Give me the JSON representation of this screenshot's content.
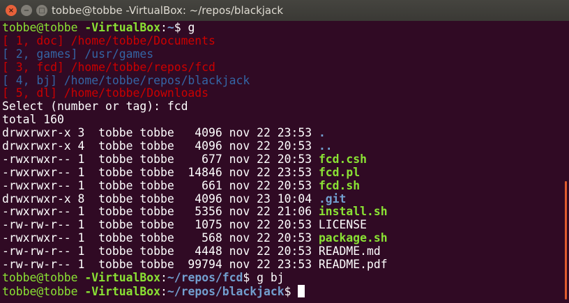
{
  "window": {
    "title": "tobbe@tobbe -VirtualBox: ~/repos/blackjack",
    "close_icon": "×",
    "minimize_icon": "−",
    "maximize_icon": "□"
  },
  "colors": {
    "background": "#300a24",
    "prompt_user": "#8ae234",
    "prompt_path": "#729fcf",
    "red": "#cc0000",
    "blue": "#3465a4",
    "scrollbar": "#e05c2e"
  },
  "terminal": {
    "lines": [
      [
        {
          "t": "tobbe@tobbe",
          "c": "ug"
        },
        {
          "t": " -VirtualBox",
          "c": "ugb"
        },
        {
          "t": ":",
          "c": "w"
        },
        {
          "t": "~",
          "c": "ubb"
        },
        {
          "t": "$ g",
          "c": "w"
        }
      ],
      [
        {
          "t": "[ 1, doc] /home/tobbe/Documents",
          "c": "red"
        }
      ],
      [
        {
          "t": "[ 2, games] /usr/games",
          "c": "blue"
        }
      ],
      [
        {
          "t": "[ 3, fcd] /home/tobbe/repos/fcd",
          "c": "red"
        }
      ],
      [
        {
          "t": "[ 4, bj] /home/tobbe/repos/blackjack",
          "c": "blue"
        }
      ],
      [
        {
          "t": "[ 5, dl] /home/tobbe/Downloads",
          "c": "red"
        }
      ],
      [
        {
          "t": "Select (number or tag): fcd",
          "c": "w"
        }
      ],
      [
        {
          "t": "total 160",
          "c": "w"
        }
      ],
      [
        {
          "t": "drwxrwxr-x 3  tobbe tobbe   4096 nov 22 23:53 ",
          "c": "w"
        },
        {
          "t": ".",
          "c": "dir"
        }
      ],
      [
        {
          "t": "drwxrwxr-x 4  tobbe tobbe   4096 nov 22 20:53 ",
          "c": "w"
        },
        {
          "t": "..",
          "c": "dir"
        }
      ],
      [
        {
          "t": "-rwxrwxr-- 1  tobbe tobbe    677 nov 22 20:53 ",
          "c": "w"
        },
        {
          "t": "fcd.csh",
          "c": "exe"
        }
      ],
      [
        {
          "t": "-rwxrwxr-- 1  tobbe tobbe  14846 nov 22 23:53 ",
          "c": "w"
        },
        {
          "t": "fcd.pl",
          "c": "exe"
        }
      ],
      [
        {
          "t": "-rwxrwxr-- 1  tobbe tobbe    661 nov 22 20:53 ",
          "c": "w"
        },
        {
          "t": "fcd.sh",
          "c": "exe"
        }
      ],
      [
        {
          "t": "drwxrwxr-x 8  tobbe tobbe   4096 nov 23 10:04 ",
          "c": "w"
        },
        {
          "t": ".git",
          "c": "dir"
        }
      ],
      [
        {
          "t": "-rwxrwxr-- 1  tobbe tobbe   5356 nov 22 21:06 ",
          "c": "w"
        },
        {
          "t": "install.sh",
          "c": "exe"
        }
      ],
      [
        {
          "t": "-rw-rw-r-- 1  tobbe tobbe   1075 nov 22 20:53 LICENSE",
          "c": "w"
        }
      ],
      [
        {
          "t": "-rwxrwxr-- 1  tobbe tobbe    568 nov 22 20:53 ",
          "c": "w"
        },
        {
          "t": "package.sh",
          "c": "exe"
        }
      ],
      [
        {
          "t": "-rw-rw-r-- 1  tobbe tobbe   4448 nov 22 20:53 README.md",
          "c": "w"
        }
      ],
      [
        {
          "t": "-rw-rw-r-- 1  tobbe tobbe  99794 nov 22 23:53 README.pdf",
          "c": "w"
        }
      ],
      [
        {
          "t": "tobbe@tobbe",
          "c": "ug"
        },
        {
          "t": " -VirtualBox",
          "c": "ugb"
        },
        {
          "t": ":",
          "c": "w"
        },
        {
          "t": "~/repos/fcd",
          "c": "ubb"
        },
        {
          "t": "$ g bj",
          "c": "w"
        }
      ],
      [
        {
          "t": "tobbe@tobbe",
          "c": "ug"
        },
        {
          "t": " -VirtualBox",
          "c": "ugb"
        },
        {
          "t": ":",
          "c": "w"
        },
        {
          "t": "~/repos/blackjack",
          "c": "ubb"
        },
        {
          "t": "$ ",
          "c": "w"
        },
        {
          "t": "",
          "c": "cursor"
        }
      ]
    ]
  }
}
